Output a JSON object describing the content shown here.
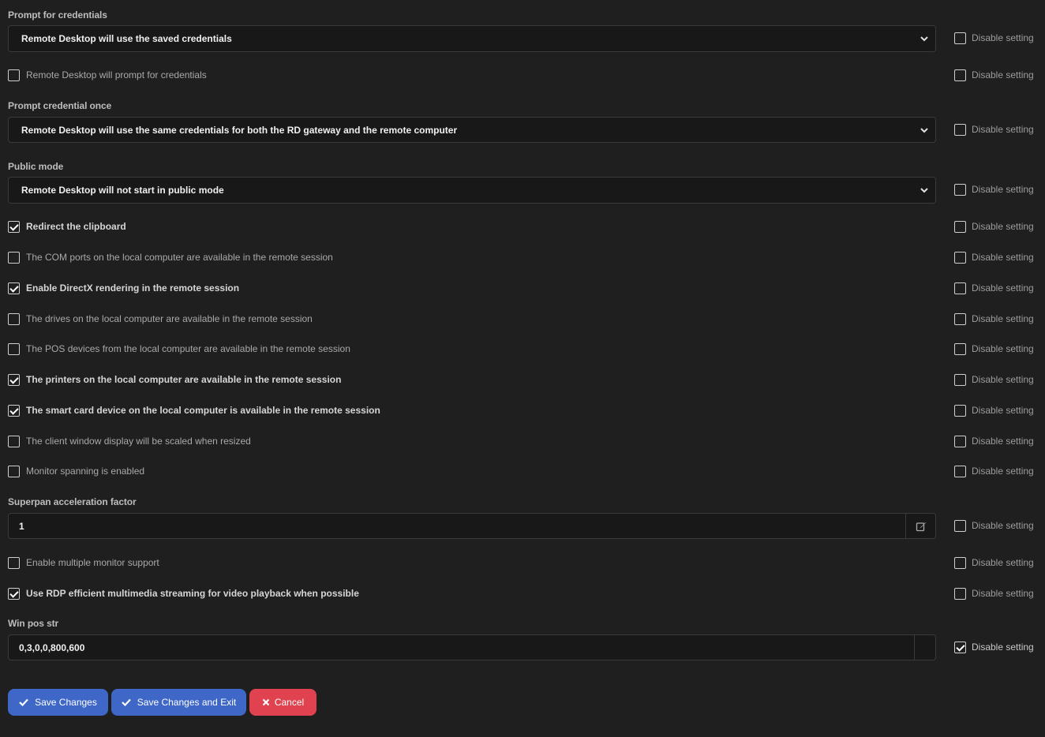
{
  "disable_label": "Disable setting",
  "fields": {
    "prompt_credentials": {
      "label": "Prompt for credentials",
      "value": "Remote Desktop will use the saved credentials",
      "disable_checked": false
    },
    "prompt_checkbox": {
      "label": "Remote Desktop will prompt for credentials",
      "checked": false,
      "disable_checked": false
    },
    "prompt_once": {
      "label": "Prompt credential once",
      "value": "Remote Desktop will use the same credentials for both the RD gateway and the remote computer",
      "disable_checked": false
    },
    "public_mode": {
      "label": "Public mode",
      "value": "Remote Desktop will not start in public mode",
      "disable_checked": false
    },
    "superpan": {
      "label": "Superpan acceleration factor",
      "value": "1",
      "disable_checked": false
    },
    "win_pos": {
      "label": "Win pos str",
      "value": "0,3,0,0,800,600",
      "disable_checked": true
    }
  },
  "checkboxes": [
    {
      "label": "Redirect the clipboard",
      "checked": true
    },
    {
      "label": "The COM ports on the local computer are available in the remote session",
      "checked": false
    },
    {
      "label": "Enable DirectX rendering in the remote session",
      "checked": true
    },
    {
      "label": "The drives on the local computer are available in the remote session",
      "checked": false
    },
    {
      "label": "The POS devices from the local computer are available in the remote session",
      "checked": false
    },
    {
      "label": "The printers on the local computer are available in the remote session",
      "checked": true
    },
    {
      "label": "The smart card device on the local computer is available in the remote session",
      "checked": true
    },
    {
      "label": "The client window display will be scaled when resized",
      "checked": false
    },
    {
      "label": "Monitor spanning is enabled",
      "checked": false
    }
  ],
  "checkboxes_after": [
    {
      "label": "Enable multiple monitor support",
      "checked": false
    },
    {
      "label": "Use RDP efficient multimedia streaming for video playback when possible",
      "checked": true
    }
  ],
  "buttons": {
    "save": "Save Changes",
    "save_exit": "Save Changes and Exit",
    "cancel": "Cancel"
  },
  "colors": {
    "primary": "#3e67c7",
    "danger": "#e0434f",
    "background": "#1f1f1f"
  }
}
